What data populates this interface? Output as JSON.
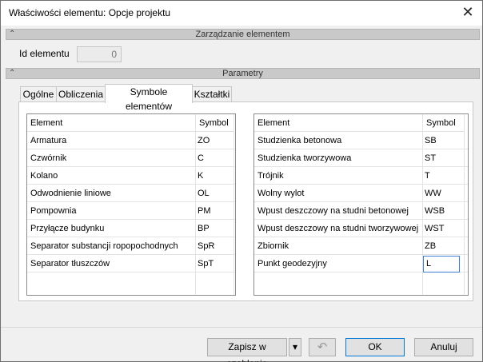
{
  "window": {
    "title": "Właściwości elementu: Opcje projektu",
    "close_glyph": "✕"
  },
  "sections": {
    "management": {
      "label": "Zarządzanie elementem",
      "chevron": "⌃"
    },
    "parameters": {
      "label": "Parametry",
      "chevron": "⌃"
    }
  },
  "id_field": {
    "label": "Id elementu",
    "value": "0"
  },
  "tabs": [
    {
      "label": "Ogólne"
    },
    {
      "label": "Obliczenia"
    },
    {
      "label": "Symbole elementów"
    },
    {
      "label": "Kształtki"
    }
  ],
  "active_tab": "Symbole elementów",
  "left_table": {
    "headers": {
      "element": "Element",
      "symbol": "Symbol"
    },
    "rows": [
      {
        "element": "Armatura",
        "symbol": "ZO"
      },
      {
        "element": "Czwórnik",
        "symbol": "C"
      },
      {
        "element": "Kolano",
        "symbol": "K"
      },
      {
        "element": "Odwodnienie liniowe",
        "symbol": "OL"
      },
      {
        "element": "Pompownia",
        "symbol": "PM"
      },
      {
        "element": "Przyłącze budynku",
        "symbol": "BP"
      },
      {
        "element": "Separator substancji ropopochodnych",
        "symbol": "SpR"
      },
      {
        "element": "Separator tłuszczów",
        "symbol": "SpT"
      }
    ]
  },
  "right_table": {
    "headers": {
      "element": "Element",
      "symbol": "Symbol"
    },
    "rows": [
      {
        "element": "Studzienka betonowa",
        "symbol": "SB"
      },
      {
        "element": "Studzienka tworzywowa",
        "symbol": "ST"
      },
      {
        "element": "Trójnik",
        "symbol": "T"
      },
      {
        "element": "Wolny wylot",
        "symbol": "WW"
      },
      {
        "element": "Wpust deszczowy na studni betonowej",
        "symbol": "WSB"
      },
      {
        "element": "Wpust deszczowy na studni tworzywowej",
        "symbol": "WST"
      },
      {
        "element": "Zbiornik",
        "symbol": "ZB"
      },
      {
        "element": "Punkt geodezyjny",
        "symbol": "L"
      }
    ]
  },
  "footer": {
    "save_template_label": "Zapisz w szablonie",
    "dropdown_glyph": "▾",
    "undo_glyph": "↶",
    "ok_label": "OK",
    "cancel_label": "Anuluj"
  }
}
